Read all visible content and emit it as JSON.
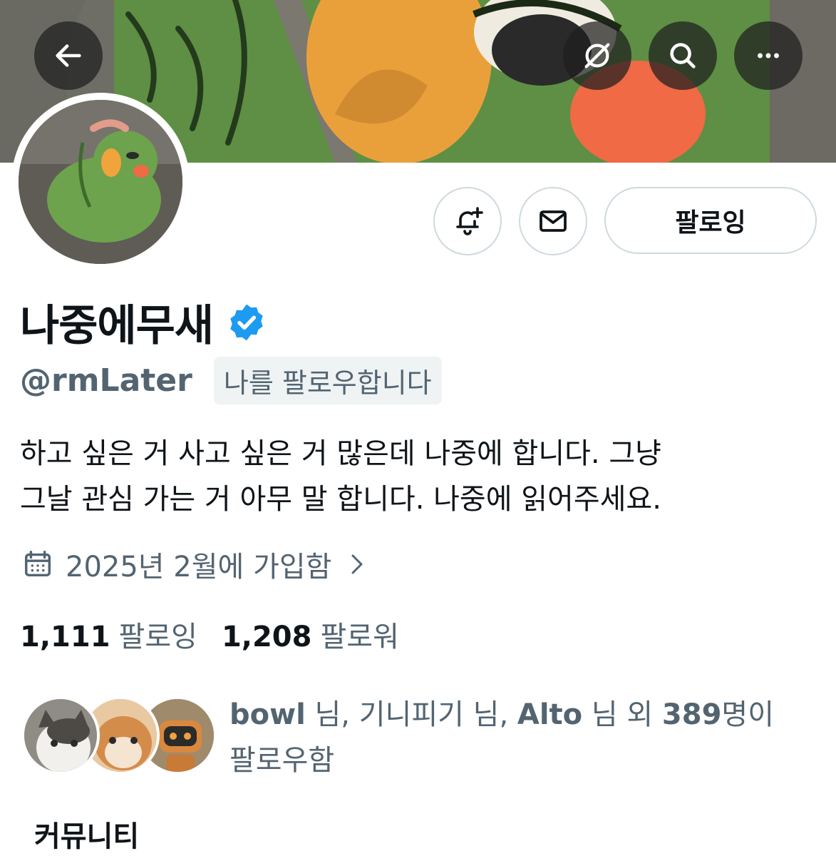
{
  "header": {
    "back_icon": "arrow-left-icon",
    "grok_icon": "grok-icon",
    "search_icon": "search-icon",
    "more_icon": "more-horizontal-icon"
  },
  "profile": {
    "display_name": "나중에무새",
    "verified_icon": "verified-badge-icon",
    "handle": "@rmLater",
    "follows_you_label": "나를 팔로우합니다",
    "bio_line1": "하고 싶은 거 사고 싶은 거 많은데 나중에 합니다. 그냥",
    "bio_line2": "그날 관심 가는 거 아무 말 합니다. 나중에 읽어주세요.",
    "joined": "2025년 2월에 가입함"
  },
  "actions": {
    "notify_icon": "bell-plus-icon",
    "message_icon": "mail-icon",
    "following_label": "팔로잉"
  },
  "stats": {
    "following_count": "1,111",
    "following_label": "팔로잉",
    "followers_count": "1,208",
    "followers_label": "팔로워"
  },
  "known_followers": {
    "name1": "bowl",
    "sep1": " 님, 기니피기 님, ",
    "name2": "Alto",
    "sep2": " 님 외 ",
    "count": "389",
    "suffix": "명이",
    "line2": "팔로우함"
  },
  "tabs": {
    "community_label": "커뮤니티"
  },
  "colors": {
    "verified": "#1d9bf0",
    "secondary_text": "#536471",
    "border": "#cfd9de"
  }
}
